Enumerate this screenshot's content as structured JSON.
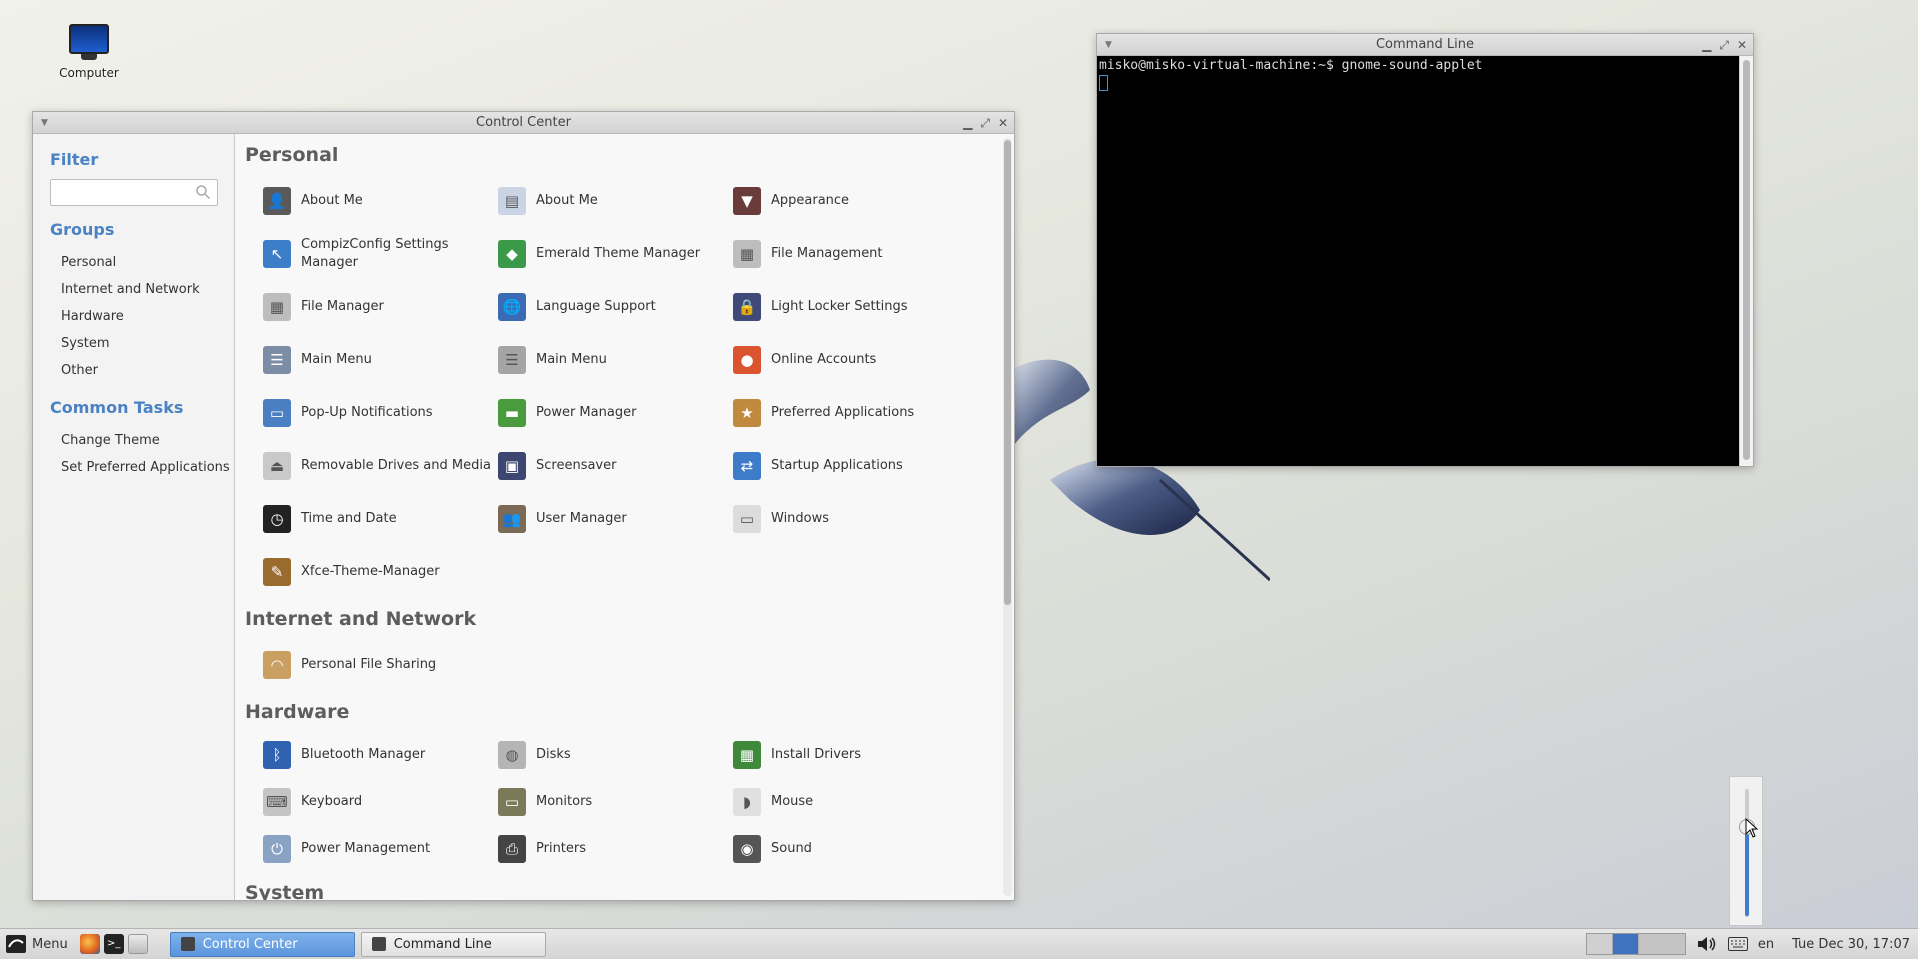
{
  "desktop": {
    "icons": [
      {
        "label": "Computer"
      }
    ]
  },
  "control_center": {
    "title": "Control Center",
    "sidebar": {
      "filter_heading": "Filter",
      "filter_placeholder": "",
      "groups_heading": "Groups",
      "groups": [
        "Personal",
        "Internet and Network",
        "Hardware",
        "System",
        "Other"
      ],
      "tasks_heading": "Common Tasks",
      "tasks": [
        "Change Theme",
        "Set Preferred Applications"
      ]
    },
    "sections": [
      {
        "title": "Personal",
        "items": [
          {
            "label": "About Me",
            "icon": "person-photo-icon"
          },
          {
            "label": "About Me",
            "icon": "id-card-icon"
          },
          {
            "label": "Appearance",
            "icon": "suit-tie-icon"
          },
          {
            "label": "CompizConfig Settings Manager",
            "icon": "compiz-cursor-icon"
          },
          {
            "label": "Emerald Theme Manager",
            "icon": "emerald-gem-icon"
          },
          {
            "label": "File Management",
            "icon": "file-cabinet-icon"
          },
          {
            "label": "File Manager",
            "icon": "file-cabinet-icon"
          },
          {
            "label": "Language Support",
            "icon": "globe-flag-icon"
          },
          {
            "label": "Light Locker Settings",
            "icon": "lock-screen-icon"
          },
          {
            "label": "Main Menu",
            "icon": "menu-editor-icon"
          },
          {
            "label": "Main Menu",
            "icon": "menu-list-icon"
          },
          {
            "label": "Online Accounts",
            "icon": "online-accounts-icon"
          },
          {
            "label": "Pop-Up Notifications",
            "icon": "notification-icon"
          },
          {
            "label": "Power Manager",
            "icon": "battery-icon"
          },
          {
            "label": "Preferred Applications",
            "icon": "preferred-apps-icon"
          },
          {
            "label": "Removable Drives and Media",
            "icon": "eject-icon"
          },
          {
            "label": "Screensaver",
            "icon": "screensaver-icon"
          },
          {
            "label": "Startup Applications",
            "icon": "startup-icon"
          },
          {
            "label": "Time and Date",
            "icon": "clock-icon"
          },
          {
            "label": "User Manager",
            "icon": "users-icon"
          },
          {
            "label": "Windows",
            "icon": "window-icon"
          },
          {
            "label": "Xfce-Theme-Manager",
            "icon": "theme-brush-icon"
          }
        ]
      },
      {
        "title": "Internet and Network",
        "items": [
          {
            "label": "Personal File Sharing",
            "icon": "file-sharing-icon"
          }
        ]
      },
      {
        "title": "Hardware",
        "items": [
          {
            "label": "Bluetooth Manager",
            "icon": "bluetooth-icon"
          },
          {
            "label": "Disks",
            "icon": "disk-icon"
          },
          {
            "label": "Install Drivers",
            "icon": "chip-icon"
          },
          {
            "label": "Keyboard",
            "icon": "keyboard-icon"
          },
          {
            "label": "Monitors",
            "icon": "monitor-icon"
          },
          {
            "label": "Mouse",
            "icon": "mouse-icon"
          },
          {
            "label": "Power Management",
            "icon": "power-icon"
          },
          {
            "label": "Printers",
            "icon": "printer-icon"
          },
          {
            "label": "Sound",
            "icon": "speaker-icon"
          }
        ]
      },
      {
        "title": "System",
        "items": []
      }
    ]
  },
  "terminal": {
    "title": "Command Line",
    "prompt": "misko@misko-virtual-machine:~$ gnome-sound-applet"
  },
  "volume": {
    "level": 0.7
  },
  "taskbar": {
    "menu_label": "Menu",
    "tasks": [
      {
        "label": "Control Center",
        "active": true
      },
      {
        "label": "Command Line",
        "active": false
      }
    ],
    "keyboard_layout": "en",
    "clock": "Tue Dec 30, 17:07"
  },
  "colors": {
    "accent": "#4a82c4",
    "taskbar_active": "#5b95dc"
  }
}
